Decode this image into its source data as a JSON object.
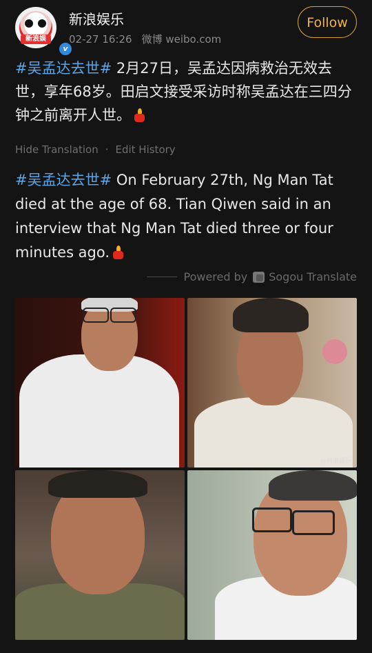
{
  "post": {
    "username": "新浪娱乐",
    "timestamp": "02-27 16:26",
    "source": "微博 weibo.com",
    "follow_label": "Follow",
    "avatar_brand": "新浪娱",
    "content_hashtag": "#吴孟达去世#",
    "content_text": " 2月27日，吴孟达因病救治无效去世，享年68岁。田启文接受采访时称吴孟达在三四分钟之前离开人世。",
    "hide_translation": "Hide Translation",
    "edit_history": "Edit History",
    "translation_hashtag": "#吴孟达去世#",
    "translation_text": " On February 27th, Ng Man Tat died at the age of 68. Tian Qiwen said in an interview that Ng Man Tat died three or four minutes ago.",
    "powered_by": "Powered by",
    "translator": "Sogou Translate",
    "photo_watermark": "@新浪娱乐"
  },
  "icons": {
    "candle": "candle-emoji",
    "verified": "verified-badge",
    "sogou": "sogou-logo"
  },
  "colors": {
    "background": "#141414",
    "hashtag": "#5aa5e6",
    "follow": "#f0b544"
  }
}
